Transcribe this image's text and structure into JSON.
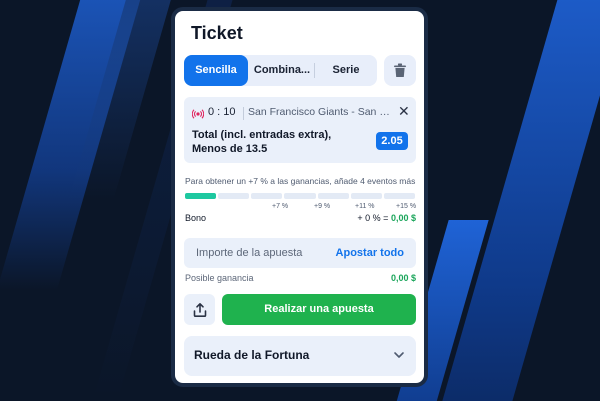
{
  "ticket": {
    "title": "Ticket",
    "tabs": [
      {
        "label": "Sencilla",
        "active": true
      },
      {
        "label": "Combina...",
        "active": false
      },
      {
        "label": "Serie",
        "active": false
      }
    ],
    "trash_icon": "trash-icon"
  },
  "selection": {
    "live_icon": "live-broadcast-icon",
    "score": "0 : 10",
    "match": "San Francisco Giants - San Diego Padres",
    "market": "Total (incl. entradas extra), Menos de 13.5",
    "odds": "2.05"
  },
  "promo": {
    "text": "Para obtener un +7 % a las ganancias, añade 4 eventos más",
    "progress_segments": 7,
    "filled_segments": 1,
    "ticks": [
      "+7 %",
      "+9 %",
      "+11 %",
      "+15 %"
    ]
  },
  "bonus": {
    "label": "Bono",
    "value_prefix": "+ 0 % =",
    "value_amount": "0,00 $"
  },
  "stake": {
    "placeholder": "Importe de la apuesta",
    "bet_all": "Apostar todo"
  },
  "gain": {
    "label": "Posible ganancia",
    "value": "0,00 $"
  },
  "actions": {
    "share_icon": "share-upload-icon",
    "place_bet": "Realizar una apuesta"
  },
  "fortune": {
    "label": "Rueda de la Fortuna",
    "chevron_icon": "chevron-down-icon"
  },
  "colors": {
    "accent": "#1273eb",
    "success": "#1fb24e",
    "progress": "#1ec8a0",
    "background": "#0b1628"
  }
}
